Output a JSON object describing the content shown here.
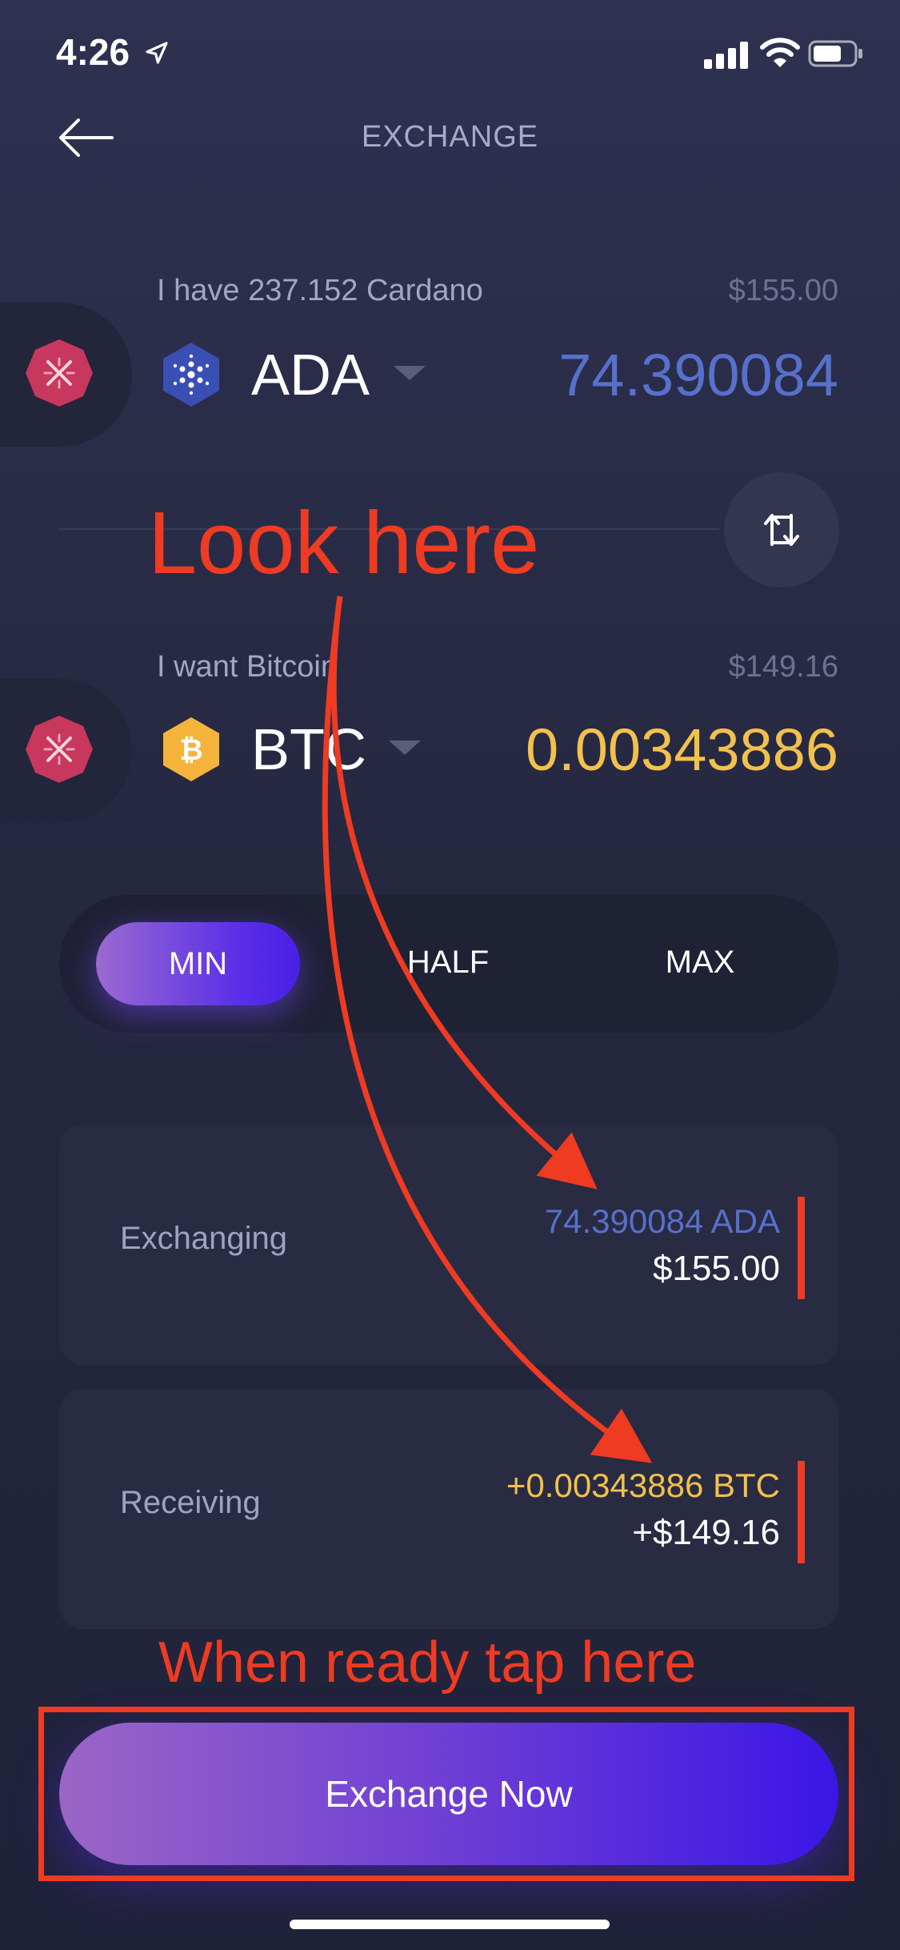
{
  "status_bar": {
    "time": "4:26"
  },
  "header": {
    "title": "EXCHANGE"
  },
  "from": {
    "label": "I have 237.152 Cardano",
    "usd": "$155.00",
    "symbol": "ADA",
    "amount": "74.390084"
  },
  "to": {
    "label": "I want Bitcoin",
    "usd": "$149.16",
    "symbol": "BTC",
    "amount": "0.00343886"
  },
  "segments": {
    "min": "MIN",
    "half": "HALF",
    "max": "MAX",
    "selected": "MIN"
  },
  "exchanging": {
    "label": "Exchanging",
    "crypto": "74.390084 ADA",
    "usd": "$155.00"
  },
  "receiving": {
    "label": "Receiving",
    "crypto": "+0.00343886 BTC",
    "usd": "+$149.16"
  },
  "cta": {
    "label": "Exchange Now"
  },
  "annotations": {
    "look_here": "Look here",
    "when_ready": "When ready tap here"
  },
  "colors": {
    "ada": "#5770cb",
    "btc": "#f2c14c",
    "remove": "#c8375e",
    "annotation": "#ee3b22"
  },
  "icons": [
    "location-arrow-icon",
    "signal-icon",
    "wifi-icon",
    "battery-icon",
    "back-arrow-icon",
    "remove-x-icon",
    "cardano-icon",
    "bitcoin-icon",
    "chevron-down-icon",
    "swap-icon"
  ]
}
